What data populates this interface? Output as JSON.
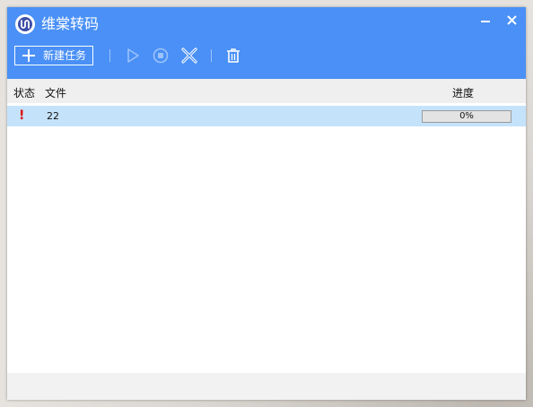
{
  "app": {
    "title": "维棠转码",
    "logo_icon": "app-logo-icon"
  },
  "window_controls": {
    "minimize_icon": "minimize-icon",
    "close_icon": "close-icon"
  },
  "toolbar": {
    "new_task_label": "新建任务",
    "new_task_icon": "plus-icon",
    "actions": [
      {
        "name": "start",
        "icon": "play-icon",
        "enabled": false
      },
      {
        "name": "stop",
        "icon": "stop-circle-icon",
        "enabled": false
      },
      {
        "name": "cancel",
        "icon": "cross-icon",
        "enabled": true
      },
      {
        "name": "delete",
        "icon": "trash-icon",
        "enabled": true
      }
    ]
  },
  "list": {
    "columns": {
      "status": "状态",
      "file": "文件",
      "progress": "进度"
    },
    "rows": [
      {
        "status_icon": "exclamation-icon",
        "status_glyph": "!",
        "file": "22",
        "progress_text": "0%",
        "progress_value": 0
      }
    ]
  },
  "colors": {
    "accent": "#4a90f6",
    "row_selected": "#c5e2fb",
    "error": "#e00000"
  }
}
